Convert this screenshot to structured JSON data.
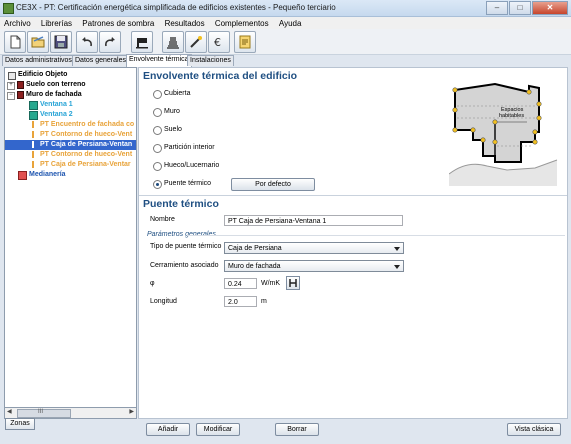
{
  "window": {
    "title": "CE3X - PT: Certificación energética simplificada de edificios existentes - Pequeño terciario"
  },
  "menu": [
    "Archivo",
    "Librerías",
    "Patrones de sombra",
    "Resultados",
    "Complementos",
    "Ayuda"
  ],
  "toolbar": {
    "icons": [
      "new-file-icon",
      "open-folder-icon",
      "save-icon",
      "undo-icon",
      "redo-icon",
      "flag-icon",
      "building-icon",
      "wand-icon",
      "euro-icon",
      "document-icon"
    ]
  },
  "tabs": [
    "Datos administrativos",
    "Datos generales",
    "Envolvente térmica",
    "Instalaciones"
  ],
  "active_tab": "Envolvente térmica",
  "tree": {
    "root": "Edificio Objeto",
    "items": [
      "Suelo con terreno",
      "Muro de fachada",
      "Ventana 1",
      "Ventana 2",
      "PT Encuentro de fachada co",
      "PT Contorno de hueco-Vent",
      "PT Caja de Persiana-Ventan",
      "PT Contorno de hueco-Vent",
      "PT Caja de Persiana-Ventar",
      "Medianería"
    ],
    "scroll_mark": "III",
    "zonas_button": "Zonas"
  },
  "envolvente": {
    "title": "Envolvente térmica del edificio",
    "options": [
      "Cubierta",
      "Muro",
      "Suelo",
      "Partición interior",
      "Hueco/Lucernario",
      "Puente térmico"
    ],
    "selected": "Puente térmico",
    "default_button": "Por defecto",
    "diagram_label_1": "Espacios",
    "diagram_label_2": "habitables"
  },
  "puente": {
    "title": "Puente térmico",
    "name_label": "Nombre",
    "name_value": "PT Caja de Persiana-Ventana 1",
    "section_label": "Parámetros generales",
    "type_label": "Tipo de puente térmico",
    "type_value": "Caja de Persiana",
    "cerramiento_label": "Cerramiento asociado",
    "cerramiento_value": "Muro de fachada",
    "phi_label": "φ",
    "phi_value": "0.24",
    "phi_unit": "W/mK",
    "length_label": "Longitud",
    "length_value": "2.0",
    "length_unit": "m"
  },
  "buttons": {
    "add": "Añadir",
    "modify": "Modificar",
    "delete": "Borrar",
    "classic": "Vista clásica"
  },
  "colors": {
    "heading": "#1f4f82",
    "tree_pt": "#e8a33a",
    "tree_selected": "#3366cc",
    "tree_link": "#1f56b0"
  }
}
